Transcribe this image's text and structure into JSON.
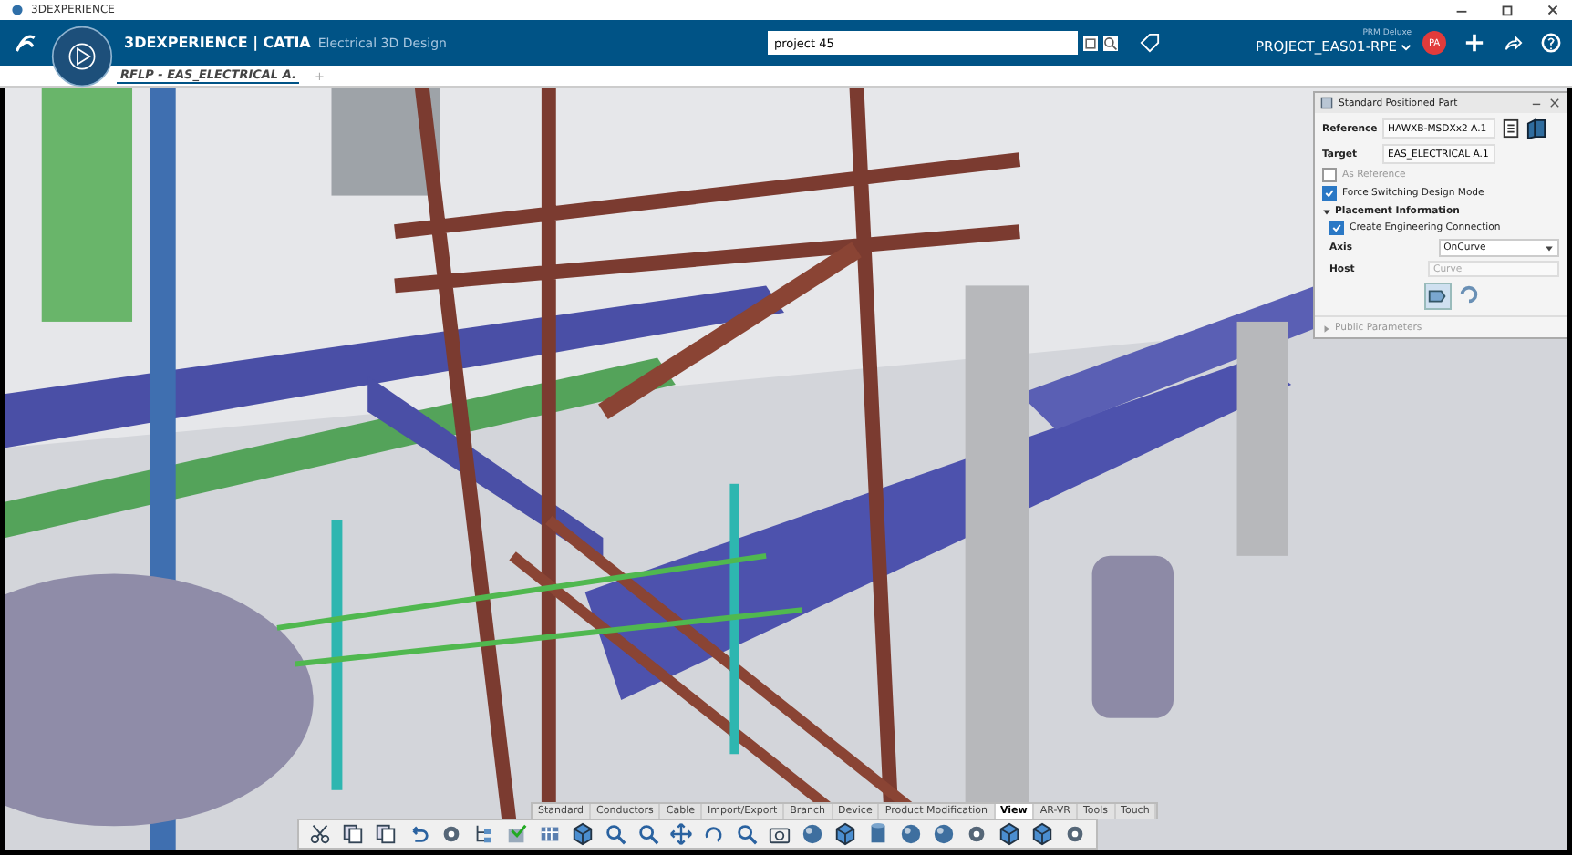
{
  "window": {
    "title": "3DEXPERIENCE"
  },
  "header": {
    "brand": "3DEXPERIENCE | CATIA",
    "app": "Electrical 3D Design",
    "search": {
      "value": "project 45"
    },
    "role": "PRM Deluxe",
    "project": "PROJECT_EAS01-RPE",
    "avatar": "PA"
  },
  "tabs": [
    {
      "label": "RFLP - EAS_ELECTRICAL A.",
      "selected": true
    }
  ],
  "add_tab": "+",
  "panel": {
    "title": "Standard Positioned Part",
    "fields": [
      {
        "label": "Reference",
        "value": "HAWXB-MSDXx2 A.1"
      },
      {
        "label": "Target",
        "value": "EAS_ELECTRICAL A.1"
      }
    ],
    "options": [
      {
        "label": "As Reference",
        "checked": false
      },
      {
        "label": "Force Switching Design Mode",
        "checked": true
      }
    ],
    "sections": [
      {
        "title": "Placement Information",
        "expanded": true
      },
      {
        "title": "Public Parameters",
        "expanded": false
      }
    ],
    "placement": {
      "option": {
        "label": "Create Engineering Connection",
        "checked": true
      },
      "axis": {
        "label": "Axis",
        "value": "OnCurve"
      },
      "host": {
        "label": "Host",
        "placeholder": "Curve"
      }
    }
  },
  "toolbar": {
    "tabs": [
      {
        "label": "Standard",
        "selected": false
      },
      {
        "label": "Conductors",
        "selected": false
      },
      {
        "label": "Cable",
        "selected": false
      },
      {
        "label": "Import/Export",
        "selected": false
      },
      {
        "label": "Branch",
        "selected": false
      },
      {
        "label": "Device",
        "selected": false
      },
      {
        "label": "Product Modification",
        "selected": false
      },
      {
        "label": "View",
        "selected": true
      },
      {
        "label": "AR-VR",
        "selected": false
      },
      {
        "label": "Tools",
        "selected": false
      },
      {
        "label": "Touch",
        "selected": false
      }
    ]
  }
}
